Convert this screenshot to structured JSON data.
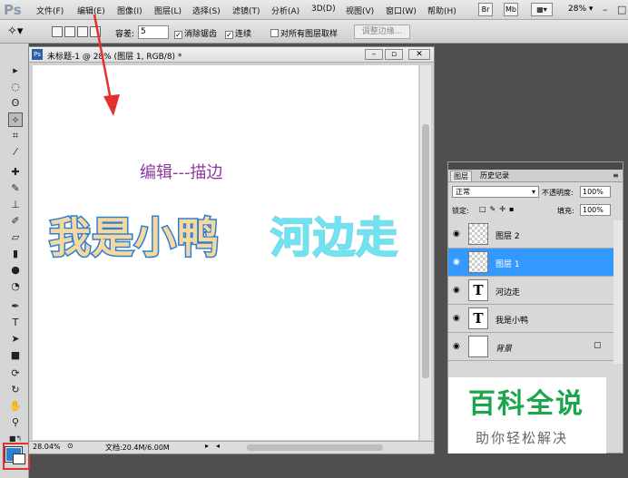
{
  "app": {
    "logo": "Ps"
  },
  "menu": {
    "items": [
      "文件(F)",
      "编辑(E)",
      "图像(I)",
      "图层(L)",
      "选择(S)",
      "滤镜(T)",
      "分析(A)",
      "3D(D)",
      "视图(V)",
      "窗口(W)",
      "帮助(H)"
    ],
    "bridge_btn": "Br",
    "mini_btn": "Mb",
    "zoom": "28%"
  },
  "options": {
    "tolerance_label": "容差:",
    "tolerance_value": "5",
    "antialias_label": "消除锯齿",
    "contiguous_label": "连续",
    "sample_all_label": "对所有图层取样",
    "refine_edge_label": "调整边缘..."
  },
  "document": {
    "title": "未标题-1 @ 28% (图层 1, RGB/8) *",
    "zoom_status": "28.04%",
    "doc_info": "文档:20.4M/6.00M",
    "annotation": "编辑---描边",
    "title_text": "我是小鸭",
    "title_text2": "河边走"
  },
  "layers_panel": {
    "tab_layers": "图层",
    "tab_history": "历史记录",
    "blend_mode": "正常",
    "opacity_label": "不透明度:",
    "opacity_value": "100%",
    "lock_label": "锁定:",
    "fill_label": "填充:",
    "fill_value": "100%",
    "layers": [
      {
        "name": "图层 2"
      },
      {
        "name": "图层 1"
      },
      {
        "name": "河边走"
      },
      {
        "name": "我是小鸭"
      },
      {
        "name": "背景"
      }
    ]
  },
  "watermark": {
    "line1": "百科全说",
    "line2": "助你轻松解决"
  },
  "colors": {
    "accent": "#3399ff",
    "annotation": "#8a3aa0",
    "highlight": "#e53030"
  }
}
